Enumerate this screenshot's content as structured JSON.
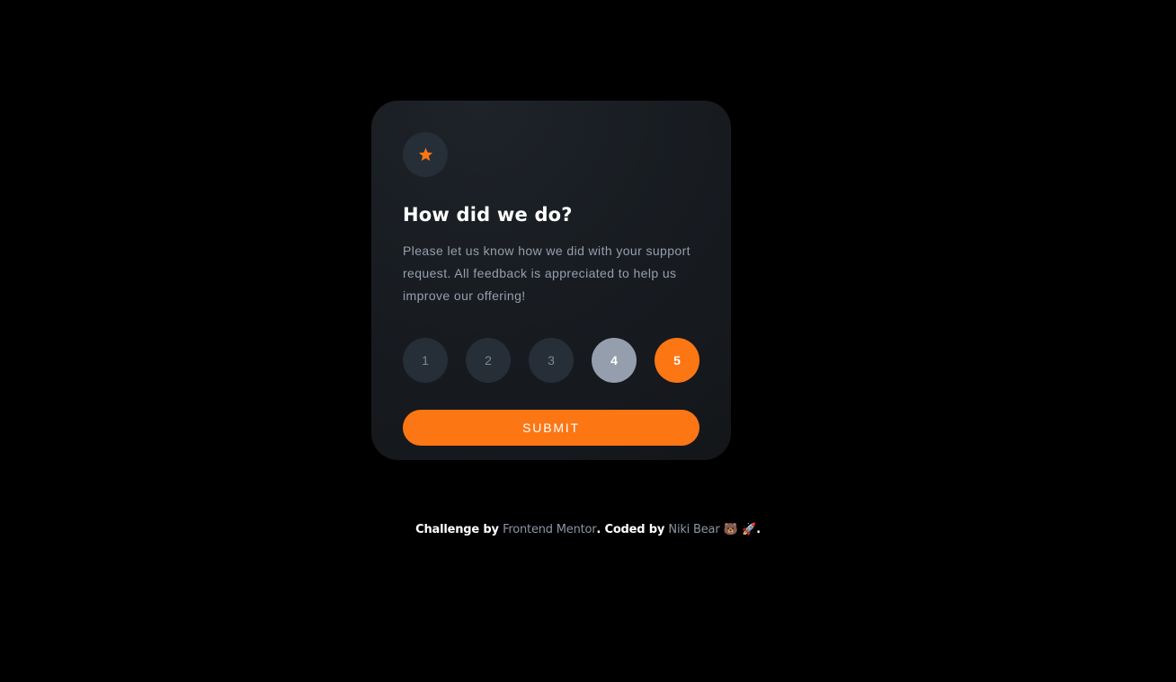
{
  "card": {
    "icon": "star-icon",
    "title": "How did we do?",
    "description": "Please let us know how we did with your support request. All feedback is appreciated to help us improve our offering!",
    "ratings": [
      "1",
      "2",
      "3",
      "4",
      "5"
    ],
    "hovered_rating": "4",
    "selected_rating": "5",
    "submit_label": "SUBMIT"
  },
  "attribution": {
    "prefix": "Challenge by ",
    "link1": "Frontend Mentor",
    "middle": ". Coded by ",
    "link2": "Niki Bear",
    "emoji": " 🐻 🚀",
    "suffix": "."
  },
  "colors": {
    "accent": "#fc7614",
    "background": "#000000",
    "card": "#171b20",
    "circle": "#262e38",
    "hover": "#959eac",
    "text_muted": "#969fad"
  }
}
